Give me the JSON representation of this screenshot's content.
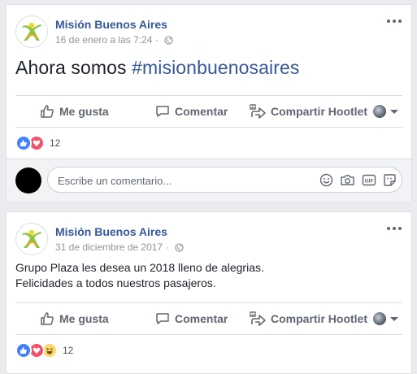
{
  "posts": [
    {
      "page_name": "Misión Buenos Aires",
      "timestamp": "16 de enero a las 7:24",
      "separator": "·",
      "text_plain": "Ahora somos ",
      "text_hashtag": "#misionbuenosaires",
      "reaction_count": "12",
      "reactions": [
        "like",
        "love"
      ]
    },
    {
      "page_name": "Misión Buenos Aires",
      "timestamp": "31 de diciembre de 2017",
      "separator": "·",
      "lines": [
        "Grupo Plaza les desea un 2018 lleno de alegrias.",
        "Felicidades a todos nuestros pasajeros."
      ],
      "reaction_count": "12",
      "reactions": [
        "like",
        "love",
        "haha"
      ]
    }
  ],
  "actions": {
    "like": "Me gusta",
    "comment": "Comentar",
    "share": "Compartir Hootlet"
  },
  "comment_input": {
    "placeholder": "Escribe un comentario..."
  },
  "icons": {
    "like": "thumbs-up-icon",
    "comment": "speech-bubble-icon",
    "share": "hootlet-share-icon",
    "emoji": "smiley-icon",
    "camera": "camera-icon",
    "gif": "gif-icon",
    "sticker": "sticker-icon",
    "privacy": "globe-icon",
    "menu": "more-options-icon"
  },
  "colors": {
    "link": "#365899",
    "like_reaction": "#4080ff",
    "love_reaction": "#f25268",
    "haha_reaction": "#fcd667"
  }
}
